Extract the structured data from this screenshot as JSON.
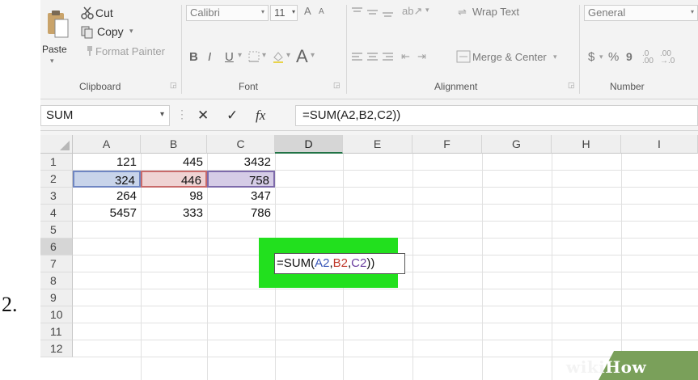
{
  "step": {
    "number": "2."
  },
  "ribbon": {
    "clipboard": {
      "paste_label": "Paste",
      "paste_arrow": "▾",
      "cut_label": "Cut",
      "copy_label": "Copy",
      "copy_arrow": "▾",
      "format_painter_label": "Format Painter",
      "group_label": "Clipboard",
      "icons": [
        "paste-icon",
        "scissors-icon",
        "copy-icon",
        "paintbrush-icon"
      ]
    },
    "font": {
      "font_name": "Calibri",
      "font_size": "11",
      "grow_label": "A",
      "shrink_label": "A",
      "bold_label": "B",
      "italic_label": "I",
      "underline_label": "U",
      "font_color_label": "A",
      "group_label": "Font"
    },
    "alignment": {
      "wrap_text_label": "Wrap Text",
      "merge_center_label": "Merge & Center",
      "group_label": "Alignment"
    },
    "number": {
      "format_value": "General",
      "currency_label": "$",
      "percent_label": "%",
      "comma_label": "9",
      "group_label": "Number"
    }
  },
  "formula_bar": {
    "name_box": "SUM",
    "cancel_label": "✕",
    "enter_label": "✓",
    "fx_label": "fx",
    "formula": "=SUM(A2,B2,C2))"
  },
  "grid": {
    "columns": [
      "A",
      "B",
      "C",
      "D",
      "E",
      "F",
      "G",
      "H",
      "I"
    ],
    "active_column": "D",
    "rows": [
      "1",
      "2",
      "3",
      "4",
      "5",
      "6",
      "7",
      "8",
      "9",
      "10",
      "11",
      "12"
    ],
    "active_row": "6",
    "cells": {
      "A1": "121",
      "B1": "445",
      "C1": "3432",
      "A2": "324",
      "B2": "446",
      "C2": "758",
      "A3": "264",
      "B3": "98",
      "C3": "347",
      "A4": "5457",
      "B4": "333",
      "C4": "786"
    },
    "editing_cell": {
      "prefix": "=SUM(",
      "ref_a": "A2",
      "comma1": ",",
      "ref_b": "B2",
      "comma2": ",",
      "ref_c": "C2",
      "suffix": "))"
    },
    "highlight_color": "#22e01e",
    "ref_colors": {
      "a": "#6f86c2",
      "b": "#c86a6a",
      "c": "#7d6aaa"
    }
  },
  "watermark": {
    "wiki": "wiki",
    "how": "How"
  }
}
